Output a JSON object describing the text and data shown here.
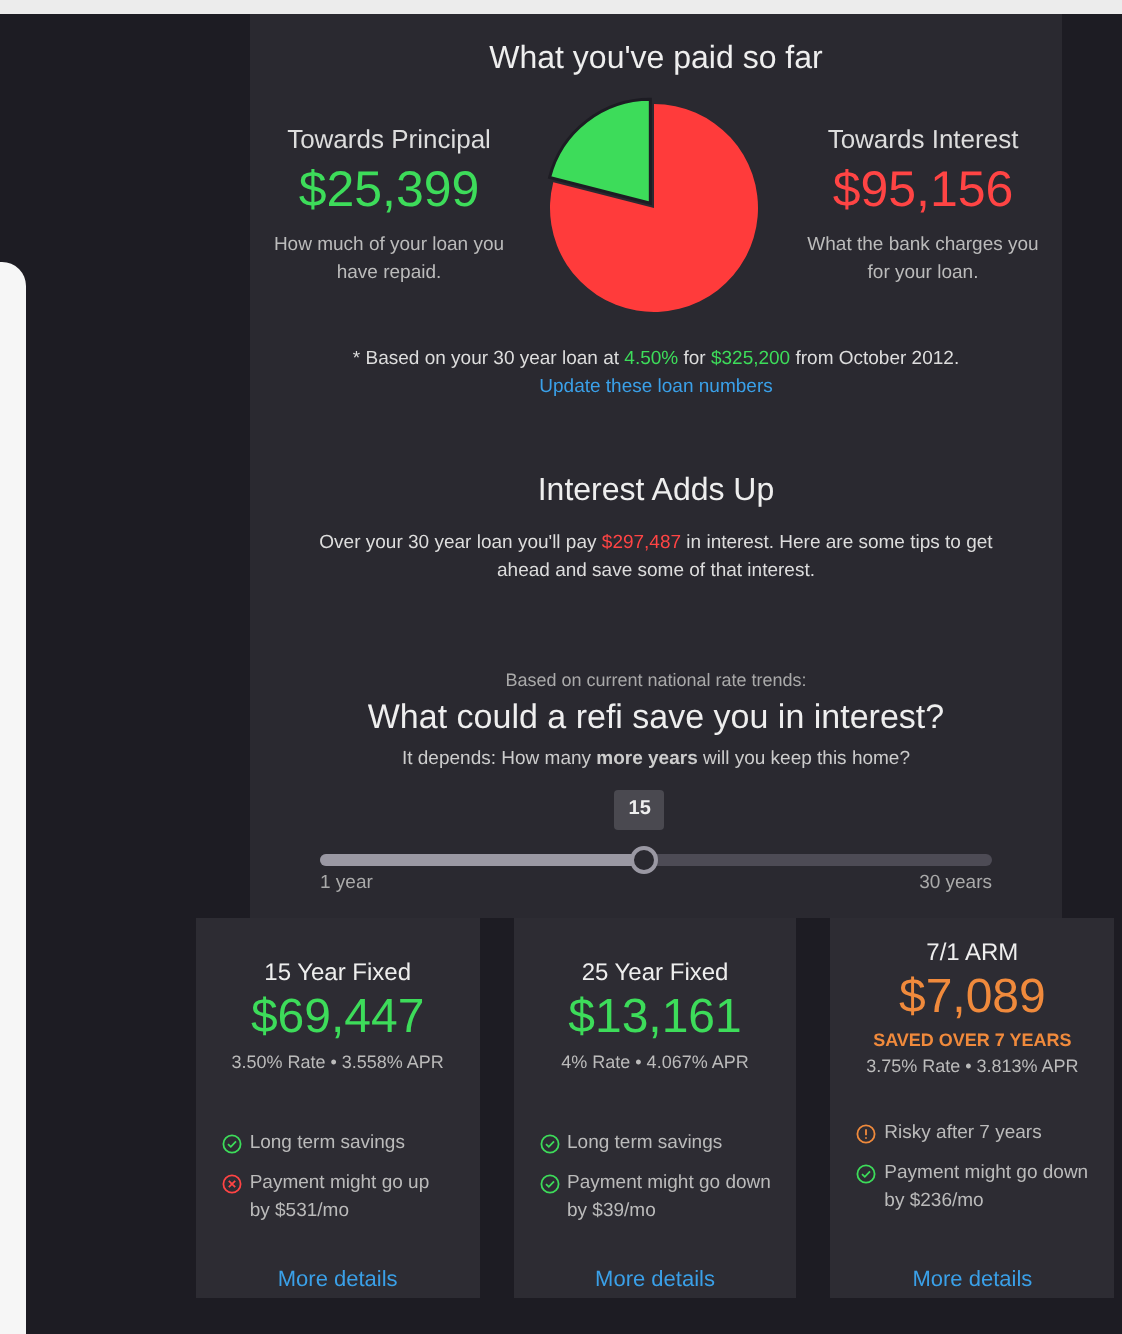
{
  "paid_section": {
    "title": "What you've paid so far",
    "principal": {
      "amount": "$25,399",
      "description": "How much of your loan you have repaid."
    },
    "interest": {
      "amount": "$95,156",
      "description": "What the bank charges you for your loan."
    },
    "chart_data": {
      "type": "pie",
      "categories": [
        "Towards Principal",
        "Towards Interest"
      ],
      "values": [
        21,
        79
      ],
      "colors": [
        "#3ddc5a",
        "#ff3b3b"
      ]
    },
    "note": [
      {
        "text": "* Based on your 30 year loan at ",
        "highlight": false
      },
      {
        "text": "4.50%",
        "highlight": true
      },
      {
        "text": " for ",
        "highlight": false
      },
      {
        "text": "$325,200",
        "highlight": true
      },
      {
        "text": " from October 2012.",
        "highlight": false
      }
    ],
    "link": "Update these loan numbers"
  },
  "interest_section": {
    "title": "Interest Adds Up",
    "text": [
      {
        "text": "Over your 30 year loan you'll pay ",
        "highlight": false
      },
      {
        "text": "$297,487",
        "highlight": true
      },
      {
        "text": " in interest. Here are some tips to get ahead and save some of that interest.",
        "highlight": false
      }
    ]
  },
  "refi_section": {
    "kicker": "Based on current national rate trends:",
    "title": "What could a refi save you in interest?",
    "question": "It depends: How many **more years** will you keep this home?",
    "slider": {
      "value": "15",
      "level": 0.483,
      "min_label": "1 year",
      "max_label": "30 years"
    }
  },
  "cards": [
    {
      "title": "15 Year Fixed",
      "amount": "$69,447",
      "color": "#3ddc5a",
      "rates": "3.50% Rate • 3.558% APR",
      "items": [
        {
          "kind": "check",
          "text": "Long term savings"
        },
        {
          "kind": "cross",
          "text": "Payment might go up by $531/mo"
        }
      ],
      "link": "More details"
    },
    {
      "title": "25 Year Fixed",
      "amount": "$13,161",
      "color": "#3ddc5a",
      "rates": "4% Rate • 4.067% APR",
      "items": [
        {
          "kind": "check",
          "text": "Long term savings"
        },
        {
          "kind": "check",
          "text": "Payment might go down by $39/mo"
        }
      ],
      "link": "More details"
    },
    {
      "title": "7/1 ARM",
      "amount": "$7,089",
      "color": "#f08a3c",
      "subtitle": "SAVED OVER 7 YEARS",
      "rates": "3.75% Rate • 3.813% APR",
      "items": [
        {
          "kind": "warning",
          "text": "Risky after 7 years"
        },
        {
          "kind": "check",
          "text": "Payment might go down by $236/mo"
        }
      ],
      "link": "More details"
    }
  ]
}
